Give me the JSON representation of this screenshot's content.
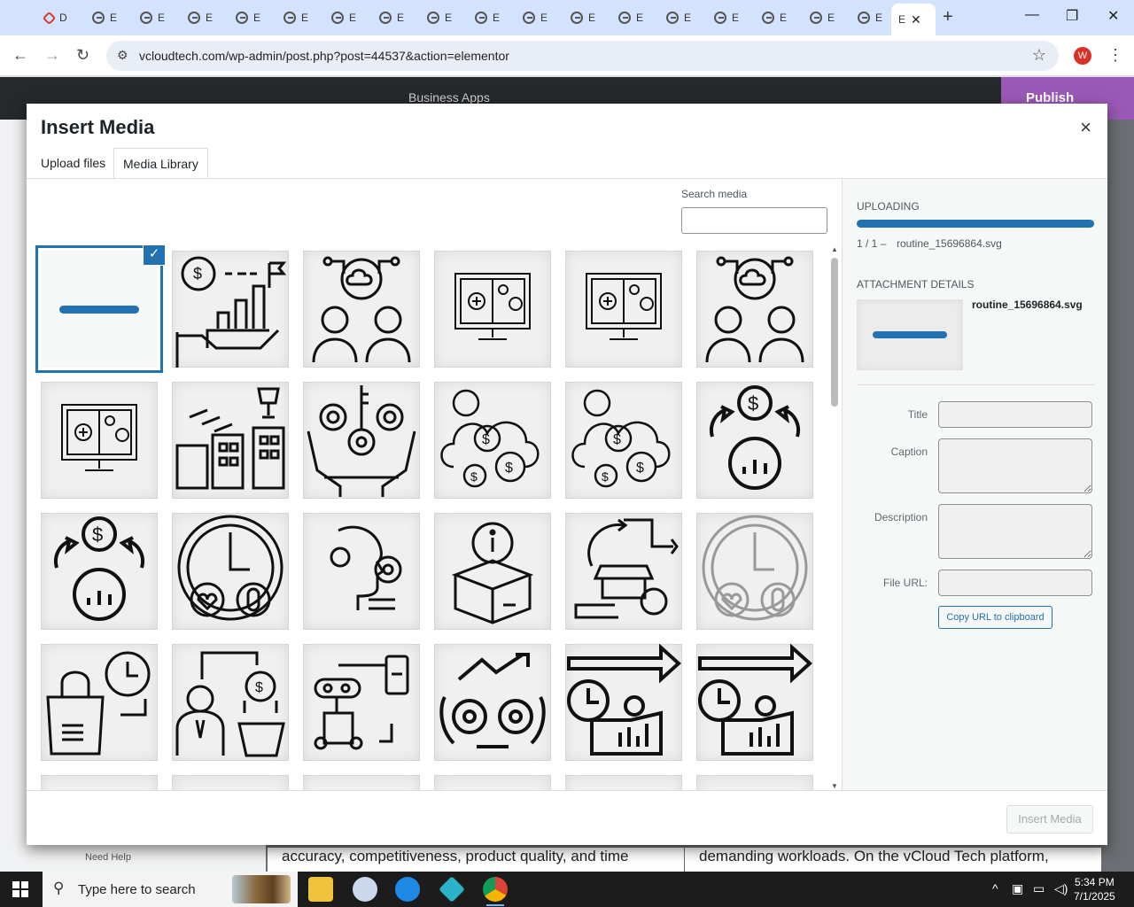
{
  "browser": {
    "tab_label": "E",
    "first_tab_label": "D",
    "active_tab_label": "E",
    "tab_close": "✕",
    "new_tab": "+",
    "url": "vcloudtech.com/wp-admin/post.php?post=44537&action=elementor",
    "profile_initial": "W",
    "controls": {
      "minimize": "—",
      "restore": "❐",
      "close": "✕"
    }
  },
  "editor": {
    "document_name": "Business Apps",
    "publish_label": "Publish",
    "need_help": "Need Help",
    "preview_text_left": "accuracy, competitiveness, product quality, and time",
    "preview_text_right": "demanding workloads. On the vCloud Tech platform,"
  },
  "modal": {
    "title": "Insert Media",
    "close_label": "×",
    "tabs": [
      {
        "label": "Upload files",
        "active": false
      },
      {
        "label": "Media Library",
        "active": true
      }
    ],
    "search": {
      "label": "Search media",
      "value": "",
      "placeholder": ""
    },
    "grid_icons": [
      [
        "horizontal-bar-icon",
        "investment-growth-icon",
        "cloud-team-icon",
        "monitor-health-settings-icon",
        "monitor-health-settings-icon",
        "cloud-team-icon"
      ],
      [
        "monitor-health-settings-icon",
        "business-growth-icon",
        "key-gears-hands-icon",
        "cloud-money-icon",
        "cloud-money-icon",
        "cost-optimization-icon"
      ],
      [
        "cost-optimization-icon",
        "health-gauge-icon",
        "ai-head-gears-icon",
        "product-info-box-icon",
        "retail-cycle-icon",
        "health-gauge-faded-icon"
      ],
      [
        "shopping-time-icon",
        "customer-purchase-flow-icon",
        "robot-mobile-icon",
        "growth-gears-icon",
        "chart-blueprint-arrow-icon",
        "chart-blueprint-arrow-icon"
      ]
    ],
    "selected_item": "horizontal-bar-icon",
    "sidebar": {
      "uploading_heading": "Uploading",
      "upload_progress": 1.0,
      "upload_count": "1 / 1",
      "upload_separator": "–",
      "upload_filename": "routine_15696864.svg",
      "attachment_heading": "Attachment Details",
      "attachment_filename": "routine_15696864.svg",
      "fields": {
        "title_label": "Title",
        "caption_label": "Caption",
        "description_label": "Description",
        "file_url_label": "File URL:",
        "title_value": "",
        "caption_value": "",
        "description_value": "",
        "file_url_value": ""
      },
      "copy_url_label": "Copy URL to clipboard"
    },
    "insert_button": "Insert Media"
  },
  "taskbar": {
    "search_placeholder": "Type here to search",
    "time": "5:34 PM",
    "date": "7/1/2025"
  },
  "colors": {
    "accent": "#2271b1",
    "publish": "#9b59b6",
    "tabstrip": "#d3e3fd"
  }
}
